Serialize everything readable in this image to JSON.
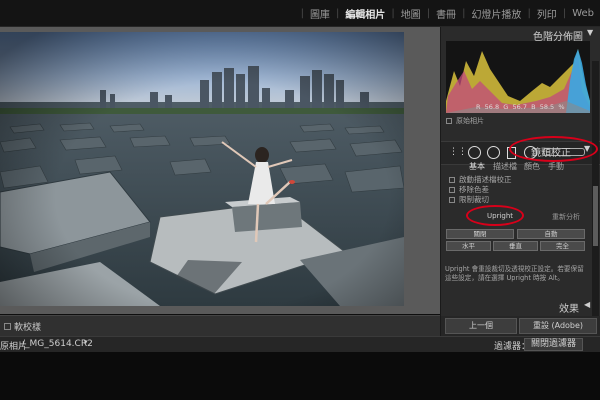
{
  "modules": [
    "圖庫",
    "編輯相片",
    "地圖",
    "書冊",
    "幻燈片播放",
    "列印",
    "Web"
  ],
  "left_toolbar": {
    "softproof_label": "軟校樣"
  },
  "filmstrip_bar": {
    "path_label": "原相片",
    "filename": "/_MG_5614.CR2",
    "filter_label": "過濾器：",
    "filter_value": "關閉過濾器"
  },
  "histogram": {
    "title": "色階分佈圖",
    "r_label": "R",
    "r_value": "56.8",
    "g_label": "G",
    "g_value": "56.7",
    "b_label": "B",
    "b_value": "58.5",
    "pct": "%",
    "original_label": "原始相片"
  },
  "lens_panel": {
    "title": "鏡頭校正",
    "tabs": [
      "基本",
      "描述檔",
      "顏色",
      "手動"
    ],
    "checks": [
      "啟動描述檔校正",
      "移除色差",
      "限制裁切"
    ],
    "upright_label": "Upright",
    "reanalyze_label": "重新分析",
    "buttons_row1": [
      "關閉",
      "自動"
    ],
    "buttons_row2": [
      "水平",
      "垂直",
      "完全"
    ],
    "note": "Upright 會重設裁切及透視校正設定。若要保留這些設定，請在選擇 Upright 時按 Alt。"
  },
  "effects_title": "效果",
  "bottom_buttons": {
    "previous": "上一個",
    "reset": "重設 (Adobe)"
  },
  "colors": {
    "annotation_red": "#d8001a",
    "panel_bg": "#2b2b2b"
  }
}
